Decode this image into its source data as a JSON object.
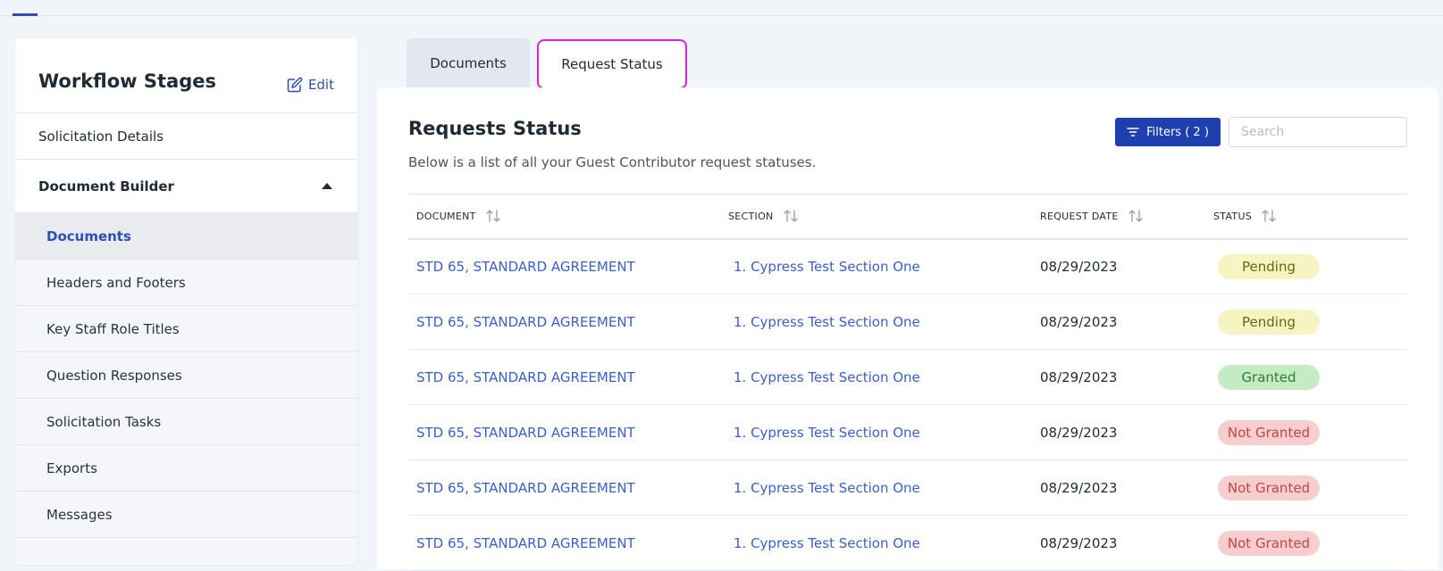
{
  "sidebar": {
    "title": "Workflow Stages",
    "edit_label": "Edit",
    "items": [
      {
        "label": "Solicitation Details"
      },
      {
        "label": "Document Builder"
      }
    ],
    "sub_items": [
      {
        "label": "Documents",
        "active": true
      },
      {
        "label": "Headers and Footers"
      },
      {
        "label": "Key Staff Role Titles"
      },
      {
        "label": "Question Responses"
      },
      {
        "label": "Solicitation Tasks"
      },
      {
        "label": "Exports"
      },
      {
        "label": "Messages"
      }
    ]
  },
  "tabs": [
    {
      "label": "Documents"
    },
    {
      "label": "Request Status"
    }
  ],
  "panel": {
    "title": "Requests Status",
    "subtitle": "Below is a list of all your Guest Contributor request statuses.",
    "filters_label": "Filters ( 2 )",
    "search_placeholder": "Search"
  },
  "table": {
    "columns": [
      "DOCUMENT",
      "SECTION",
      "REQUEST DATE",
      "STATUS"
    ],
    "rows": [
      {
        "document": "STD 65, STANDARD AGREEMENT",
        "section": "1. Cypress Test Section One",
        "date": "08/29/2023",
        "status": "Pending"
      },
      {
        "document": "STD 65, STANDARD AGREEMENT",
        "section": "1. Cypress Test Section One",
        "date": "08/29/2023",
        "status": "Pending"
      },
      {
        "document": "STD 65, STANDARD AGREEMENT",
        "section": "1. Cypress Test Section One",
        "date": "08/29/2023",
        "status": "Granted"
      },
      {
        "document": "STD 65, STANDARD AGREEMENT",
        "section": "1. Cypress Test Section One",
        "date": "08/29/2023",
        "status": "Not Granted"
      },
      {
        "document": "STD 65, STANDARD AGREEMENT",
        "section": "1. Cypress Test Section One",
        "date": "08/29/2023",
        "status": "Not Granted"
      },
      {
        "document": "STD 65, STANDARD AGREEMENT",
        "section": "1. Cypress Test Section One",
        "date": "08/29/2023",
        "status": "Not Granted"
      }
    ]
  },
  "colors": {
    "accent": "#1e40af",
    "link": "#3b5fc9",
    "highlight_border": "#e61ee6"
  }
}
